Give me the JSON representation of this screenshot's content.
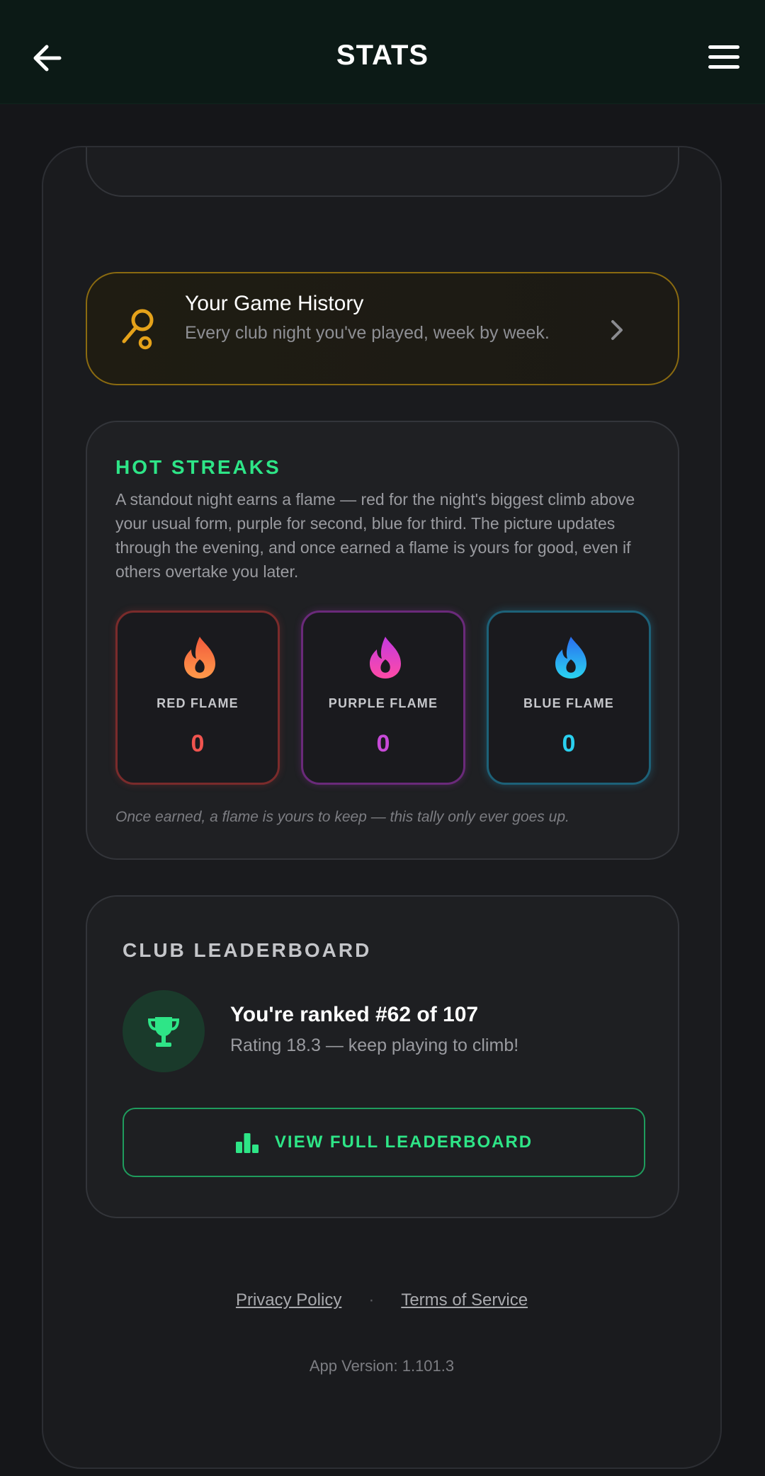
{
  "header": {
    "title": "STATS",
    "back_icon": "arrow-left-icon",
    "menu_icon": "hamburger-menu-icon"
  },
  "history": {
    "title": "Your Game History",
    "subtitle": "Every club night you've played, week by week.",
    "icon": "racket-icon",
    "accent": "#e5a21a"
  },
  "streaks": {
    "heading": "HOT STREAKS",
    "description": "A standout night earns a flame — red for the night's biggest climb above your usual form, purple for second, blue for third. The picture updates through the evening, and once earned a flame is yours for good, even if others overtake you later.",
    "flames": [
      {
        "label": "RED FLAME",
        "count": "0",
        "color": "#f0544f"
      },
      {
        "label": "PURPLE FLAME",
        "count": "0",
        "color": "#c84ad8"
      },
      {
        "label": "BLUE FLAME",
        "count": "0",
        "color": "#2ad0ef"
      }
    ],
    "note": "Once earned, a flame is yours to keep — this tally only ever goes up."
  },
  "leaderboard": {
    "heading": "CLUB LEADERBOARD",
    "rank_text": "You're ranked #62 of 107",
    "rating_text": "Rating 18.3 — keep playing to climb!",
    "button_label": "VIEW FULL LEADERBOARD",
    "accent": "#2ee587"
  },
  "footer": {
    "privacy": "Privacy Policy",
    "separator": "·",
    "terms": "Terms of Service",
    "version": "App Version: 1.101.3"
  }
}
